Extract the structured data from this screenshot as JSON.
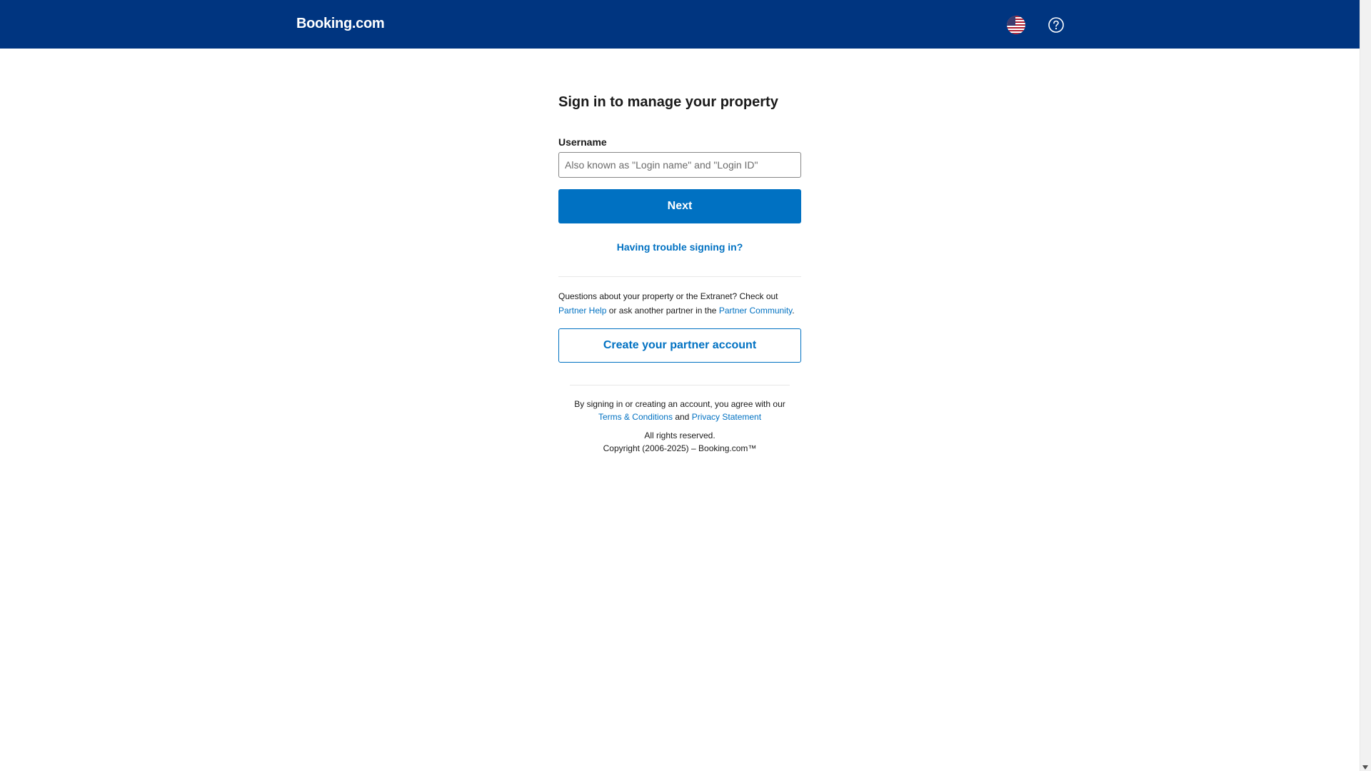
{
  "header": {
    "logo": "Booking.com",
    "language_icon": "us-flag-icon",
    "help_icon": "help-circle-icon",
    "background_color": "#003580"
  },
  "signin": {
    "title": "Sign in to manage your property",
    "username_label": "Username",
    "username_value": "",
    "username_placeholder": "Also known as \"Login name\" and \"Login ID\"",
    "next_label": "Next",
    "trouble_link": "Having trouble signing in?"
  },
  "help": {
    "text_1": "Questions about your property or the Extranet? Check out",
    "partner_help_link": "Partner Help",
    "text_2": " or ask another partner in the ",
    "partner_community_link": "Partner Community",
    "text_3": "."
  },
  "create_account_label": "Create your partner account",
  "legal": {
    "text_1": "By signing in or creating an account, you agree with our",
    "terms_link": "Terms & Conditions",
    "and": " and ",
    "privacy_link": "Privacy Statement",
    "rights": "All rights reserved.",
    "copyright": "Copyright (2006-2025) – Booking.com™"
  },
  "colors": {
    "brand_blue": "#003580",
    "action_blue": "#0071c2"
  }
}
